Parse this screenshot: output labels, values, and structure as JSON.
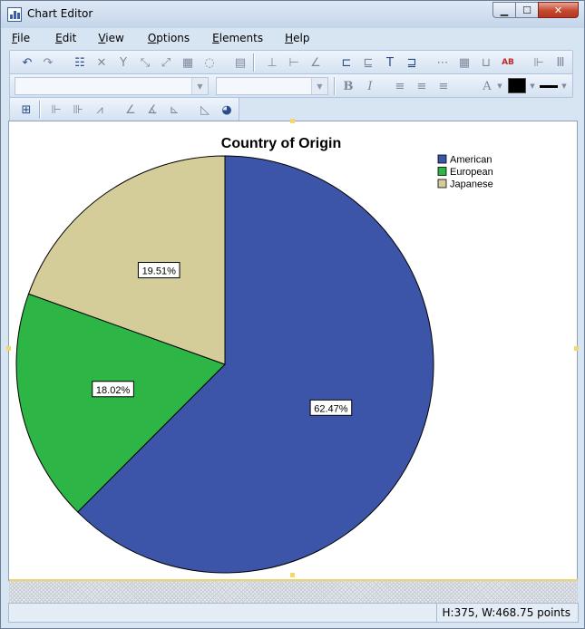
{
  "window": {
    "title": "Chart Editor"
  },
  "menu": [
    {
      "first": "F",
      "rest": "ile"
    },
    {
      "first": "E",
      "rest": "dit"
    },
    {
      "first": "V",
      "rest": "iew"
    },
    {
      "first": "O",
      "rest": "ptions"
    },
    {
      "first": "E",
      "rest": "lements"
    },
    {
      "first": "H",
      "rest": "elp"
    }
  ],
  "format_toolbar": {
    "font_dropdown": "",
    "size_dropdown": "",
    "bold": "B",
    "italic": "I",
    "font_color_letter": "A"
  },
  "status": {
    "dimensions": "H:375, W:468.75 points"
  },
  "chart_data": {
    "type": "pie",
    "title": "Country of Origin",
    "categories": [
      "American",
      "European",
      "Japanese"
    ],
    "values": [
      62.47,
      18.02,
      19.51
    ],
    "labels": [
      "62.47%",
      "18.02%",
      "19.51%"
    ],
    "colors": [
      "#3d55a8",
      "#2db546",
      "#d4cd9a"
    ],
    "legend_position": "top-right"
  }
}
